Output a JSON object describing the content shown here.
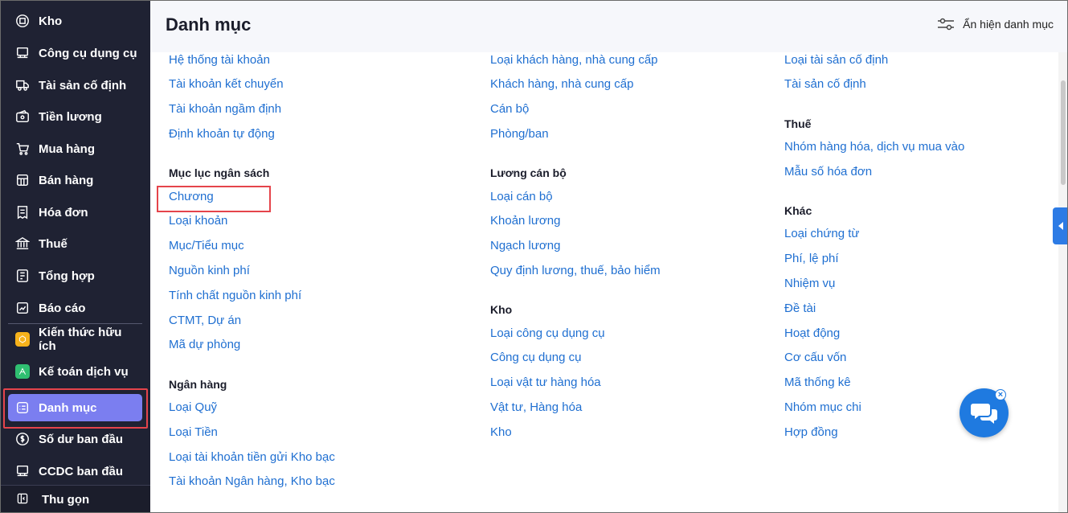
{
  "sidebar": {
    "items": [
      {
        "label": "Kho",
        "icon": "box-icon"
      },
      {
        "label": "Công cụ dụng cụ",
        "icon": "tools-icon"
      },
      {
        "label": "Tài sản cố định",
        "icon": "truck-icon"
      },
      {
        "label": "Tiền lương",
        "icon": "wallet-icon"
      },
      {
        "label": "Mua hàng",
        "icon": "cart-icon"
      },
      {
        "label": "Bán hàng",
        "icon": "store-icon"
      },
      {
        "label": "Hóa đơn",
        "icon": "invoice-icon"
      },
      {
        "label": "Thuế",
        "icon": "bank-icon"
      },
      {
        "label": "Tổng hợp",
        "icon": "ledger-icon"
      },
      {
        "label": "Báo cáo",
        "icon": "report-icon"
      },
      {
        "label": "Kiến thức hữu ích",
        "icon": "knowledge-icon"
      },
      {
        "label": "Kế toán dịch vụ",
        "icon": "service-icon"
      },
      {
        "label": "Danh mục",
        "icon": "catalog-icon",
        "active": true
      },
      {
        "label": "Số dư ban đầu",
        "icon": "balance-icon"
      },
      {
        "label": "CCDC ban đầu",
        "icon": "initial-tools-icon"
      }
    ],
    "collapse_label": "Thu gọn"
  },
  "header": {
    "title": "Danh mục",
    "toggle_label": "Ẩn hiện danh mục"
  },
  "columns": [
    {
      "groups": [
        {
          "title": "",
          "links": [
            "Hệ thống tài khoản",
            "Tài khoản kết chuyển",
            "Tài khoản ngầm định",
            "Định khoản tự động"
          ]
        },
        {
          "title": "Mục lục ngân sách",
          "links": [
            "Chương",
            "Loại khoản",
            "Mục/Tiểu mục",
            "Nguồn kinh phí",
            "Tính chất nguồn kinh phí",
            "CTMT, Dự án",
            "Mã dự phòng"
          ]
        },
        {
          "title": "Ngân hàng",
          "links": [
            "Loại Quỹ",
            "Loại Tiền",
            "Loại tài khoản tiền gửi Kho bạc",
            "Tài khoản Ngân hàng, Kho bạc"
          ]
        }
      ]
    },
    {
      "groups": [
        {
          "title": "",
          "links": [
            "Loại khách hàng, nhà cung cấp",
            "Khách hàng, nhà cung cấp",
            "Cán bộ",
            "Phòng/ban"
          ]
        },
        {
          "title": "Lương cán bộ",
          "links": [
            "Loại cán bộ",
            "Khoản lương",
            "Ngạch lương",
            "Quy định lương, thuế, bảo hiểm"
          ]
        },
        {
          "title": "Kho",
          "links": [
            "Loại công cụ dụng cụ",
            "Công cụ dụng cụ",
            "Loại vật tư hàng hóa",
            "Vật tư, Hàng hóa",
            "Kho"
          ]
        }
      ]
    },
    {
      "groups": [
        {
          "title": "",
          "links": [
            "Loại tài sản cố định",
            "Tài sản cố định"
          ]
        },
        {
          "title": "Thuế",
          "links": [
            "Nhóm hàng hóa, dịch vụ mua vào",
            "Mẫu số hóa đơn"
          ]
        },
        {
          "title": "Khác",
          "links": [
            "Loại chứng từ",
            "Phí, lệ phí",
            "Nhiệm vụ",
            "Đề tài",
            "Hoạt động",
            "Cơ cấu vốn",
            "Mã thống kê",
            "Nhóm mục chi",
            "Hợp đồng"
          ]
        }
      ]
    }
  ],
  "colors": {
    "sidebar_bg": "#1f2233",
    "active_bg": "#7b7ef0",
    "link": "#1f6fd1",
    "highlight": "#e5444b",
    "chat": "#1f7ae0"
  }
}
